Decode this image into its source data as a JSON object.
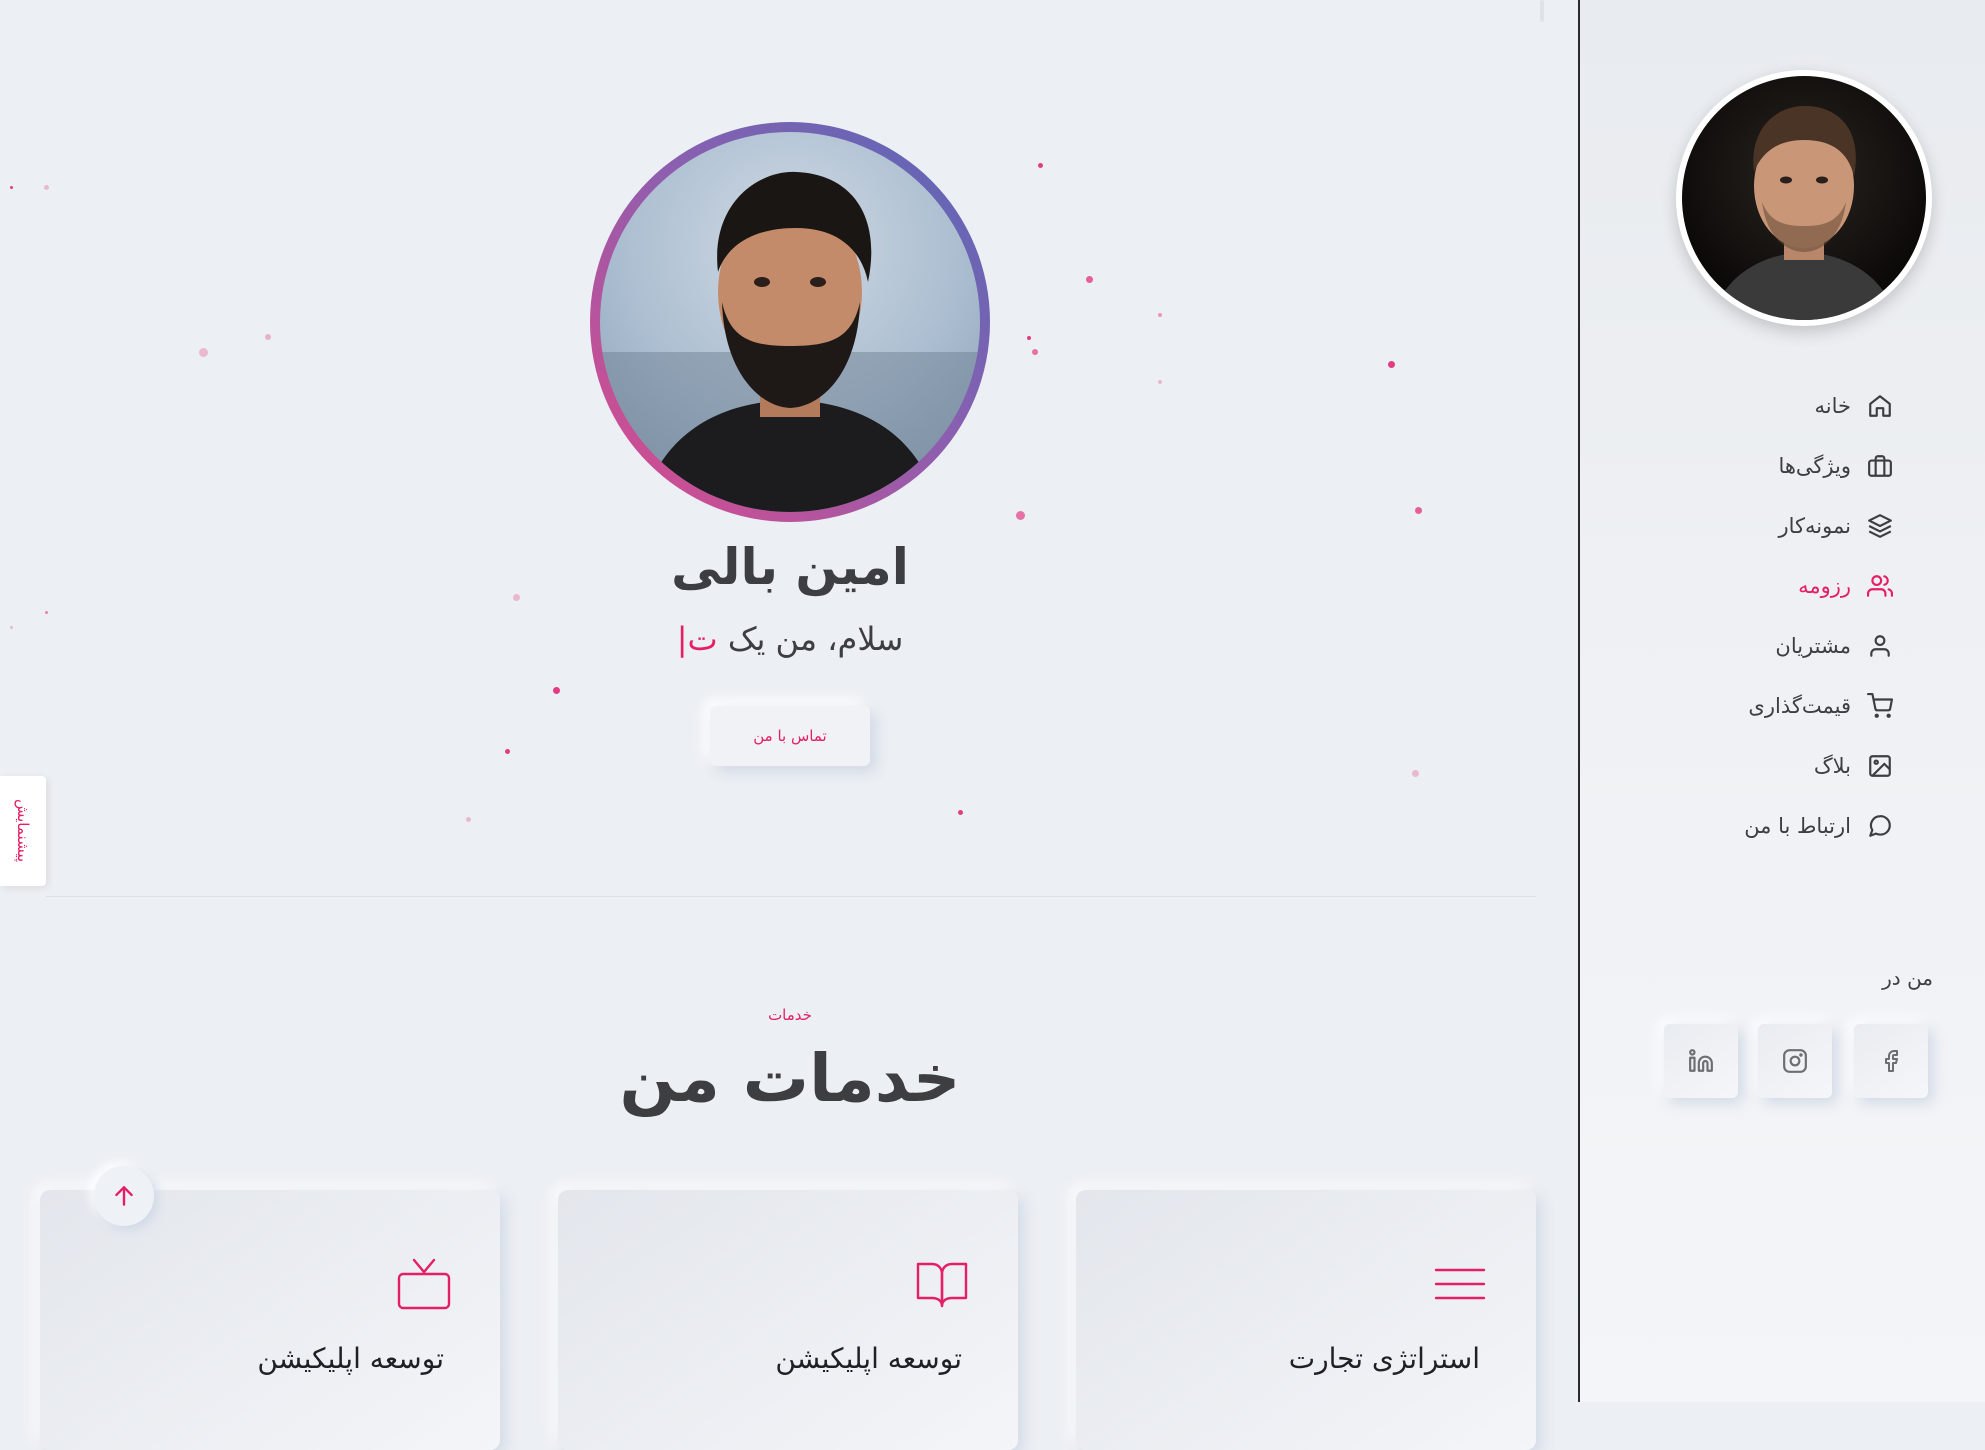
{
  "hero": {
    "name": "امین بالی",
    "greeting_prefix": "سلام، من یک",
    "greeting_typed": "ت",
    "cursor": "|",
    "contact_label": "تماس با من",
    "demo_label": "پیشنمایش"
  },
  "services": {
    "subtitle": "خدمات",
    "title": "خدمات من",
    "cards": [
      {
        "title": "استراتژی تجارت",
        "icon": "menu-icon"
      },
      {
        "title": "توسعه اپلیکیشن",
        "icon": "book-icon"
      },
      {
        "title": "توسعه اپلیکیشن",
        "icon": "tv-icon"
      }
    ]
  },
  "sidebar": {
    "nav": [
      {
        "label": "خانه",
        "icon": "home-icon"
      },
      {
        "label": "ویژگی‌ها",
        "icon": "briefcase-icon"
      },
      {
        "label": "نمونه‌کار",
        "icon": "layers-icon"
      },
      {
        "label": "رزومه",
        "icon": "users-icon",
        "active": true
      },
      {
        "label": "مشتریان",
        "icon": "user-icon"
      },
      {
        "label": "قیمت‌گذاری",
        "icon": "cart-icon"
      },
      {
        "label": "بلاگ",
        "icon": "image-icon"
      },
      {
        "label": "ارتباط با من",
        "icon": "message-circle-icon"
      }
    ],
    "find_me": "من در",
    "social": [
      "facebook-icon",
      "instagram-icon",
      "linkedin-icon"
    ]
  },
  "colors": {
    "accent": "#e41f63",
    "text": "#3c3e41",
    "background": "#eceff3"
  }
}
